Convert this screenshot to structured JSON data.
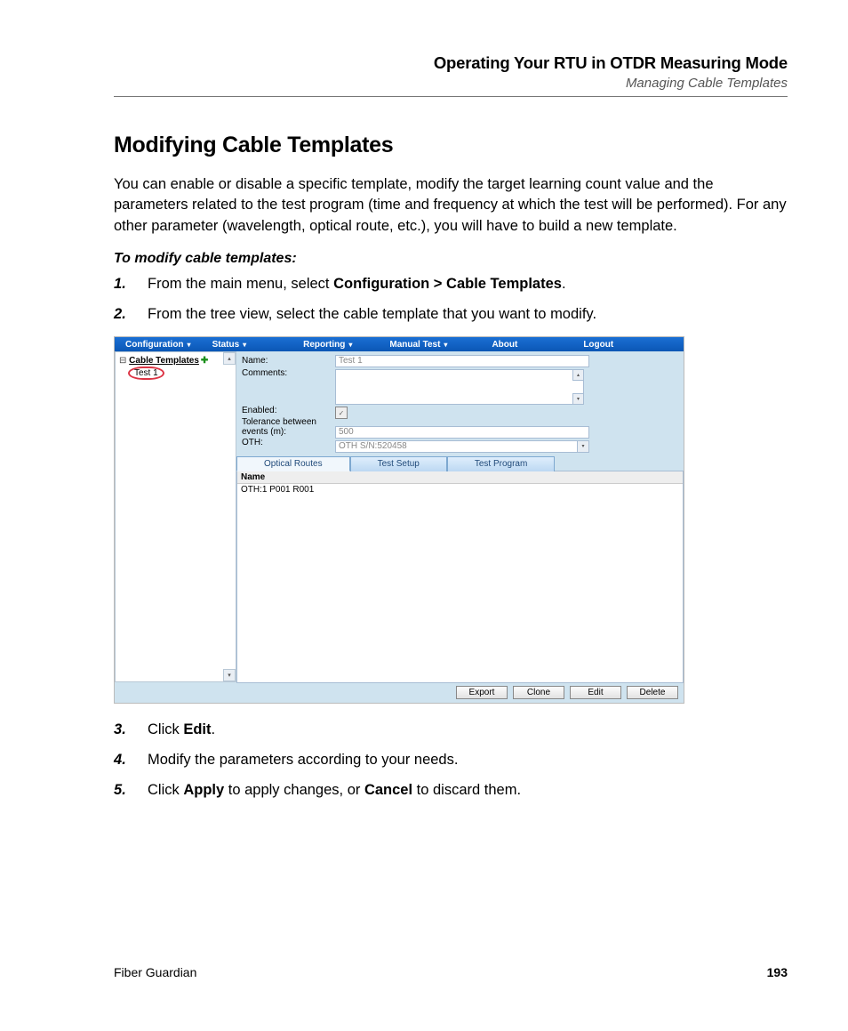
{
  "header": {
    "title": "Operating Your RTU in OTDR Measuring Mode",
    "subtitle": "Managing Cable Templates"
  },
  "section": {
    "heading": "Modifying Cable Templates",
    "intro": "You can enable or disable a specific template, modify the target learning count value and the parameters related to the test program (time and frequency at which the test will be performed). For any other parameter (wavelength, optical route, etc.), you will have to build a new template.",
    "subhead": "To modify cable templates:",
    "step1_a": "From the main menu, select ",
    "step1_b": "Configuration > Cable Templates",
    "step1_c": ".",
    "step2": "From the tree view, select the cable template that you want to modify.",
    "step3_a": "Click ",
    "step3_b": "Edit",
    "step3_c": ".",
    "step4": "Modify the parameters according to your needs.",
    "step5_a": "Click ",
    "step5_b": "Apply",
    "step5_c": " to apply changes, or ",
    "step5_d": "Cancel",
    "step5_e": " to discard them."
  },
  "app": {
    "menu": {
      "configuration": "Configuration",
      "status": "Status",
      "reporting": "Reporting",
      "manualtest": "Manual Test",
      "about": "About",
      "logout": "Logout"
    },
    "tree": {
      "root": "Cable Templates",
      "child": "Test 1"
    },
    "form": {
      "labels": {
        "name": "Name:",
        "comments": "Comments:",
        "enabled": "Enabled:",
        "tolerance": "Tolerance between events (m):",
        "oth": "OTH:"
      },
      "values": {
        "name": "Test 1",
        "tolerance": "500",
        "oth": "OTH S/N:520458"
      }
    },
    "tabs": {
      "routes": "Optical Routes",
      "setup": "Test Setup",
      "program": "Test Program"
    },
    "grid": {
      "header": "Name",
      "row1": "OTH:1 P001 R001"
    },
    "buttons": {
      "export": "Export",
      "clone": "Clone",
      "edit": "Edit",
      "delete": "Delete"
    }
  },
  "footer": {
    "product": "Fiber Guardian",
    "page": "193"
  }
}
